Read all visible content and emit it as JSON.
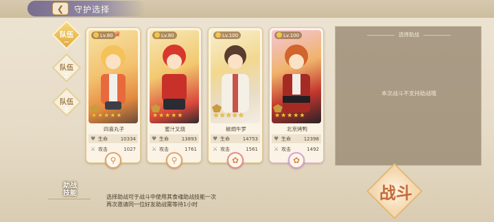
{
  "header": {
    "title": "守护选择",
    "back_icon": "back-arrow-icon"
  },
  "team_tabs": [
    {
      "label": "队伍",
      "number": "一",
      "active": true
    },
    {
      "label": "队伍",
      "number": "二",
      "active": false
    },
    {
      "label": "队伍",
      "number": "三",
      "active": false
    }
  ],
  "cards": [
    {
      "level": "Lv.80",
      "name": "四喜丸子",
      "hp_label": "生命",
      "hp": "10334",
      "atk_label": "攻击",
      "atk": "1027",
      "stars": 5
    },
    {
      "level": "Lv.80",
      "name": "蜜汁叉烧",
      "hp_label": "生命",
      "hp": "13893",
      "atk_label": "攻击",
      "atk": "1761",
      "stars": 5
    },
    {
      "level": "Lv.100",
      "name": "椒焗牛罗",
      "hp_label": "生命",
      "hp": "14753",
      "atk_label": "攻击",
      "atk": "1561",
      "stars": 5
    },
    {
      "level": "Lv.100",
      "name": "北京烤鸭",
      "hp_label": "生命",
      "hp": "12398",
      "atk_label": "攻击",
      "atk": "1492",
      "stars": 5
    }
  ],
  "support": {
    "header": "选择助战",
    "message": "本次战斗不支持助战哦"
  },
  "assist": {
    "title_line1": "助战",
    "title_line2": "技能",
    "desc_line1": "选择助战可于战斗中使用其食魂助战技能一次",
    "desc_line2": "再次邀请同一位好友助战需等待1小时"
  },
  "battle": {
    "label": "战斗"
  },
  "colors": {
    "accent_gold": "#e1a93d",
    "panel_bg": "#968770",
    "battle_text": "#c56a3a"
  }
}
